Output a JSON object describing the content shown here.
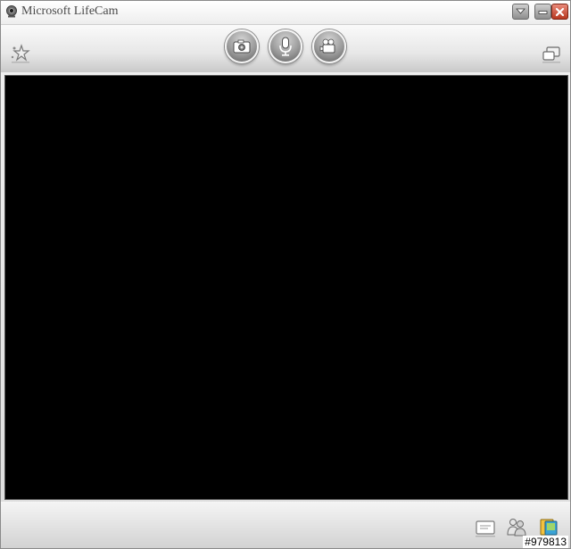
{
  "window": {
    "title": "Microsoft LifeCam"
  },
  "icons": {
    "app": "webcam-icon",
    "effects": "effects-star-icon",
    "photo": "camera-icon",
    "audio": "microphone-icon",
    "video": "video-camera-icon",
    "compact_view": "compact-view-icon",
    "message": "message-icon",
    "people": "people-icon",
    "gallery": "gallery-icon"
  },
  "watermark": "#979813",
  "colors": {
    "video_background": "#000000",
    "close_button": "#b73820"
  }
}
